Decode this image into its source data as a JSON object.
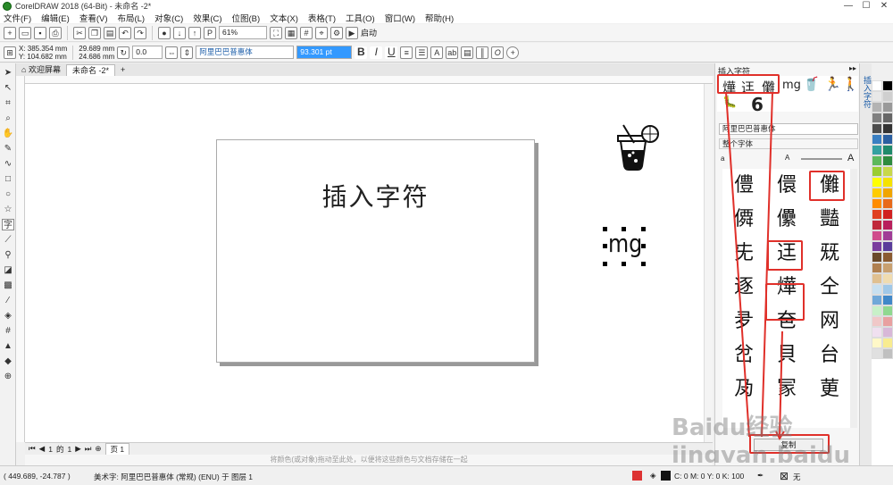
{
  "window": {
    "title": "CorelDRAW 2018 (64-Bit) - 未命名 -2*",
    "min": "—",
    "max": "☐",
    "close": "✕"
  },
  "menu": [
    "文件(F)",
    "编辑(E)",
    "查看(V)",
    "布局(L)",
    "对象(C)",
    "效果(C)",
    "位图(B)",
    "文本(X)",
    "表格(T)",
    "工具(O)",
    "窗口(W)",
    "帮助(H)"
  ],
  "toolbar1": {
    "zoom": "61%",
    "launch": "启动"
  },
  "toolbar2": {
    "x": "X: 385.354 mm",
    "y": "Y: 104.682 mm",
    "w": "29.689 mm",
    "h": "24.686 mm",
    "angle": "0.0",
    "font": "阿里巴巴普惠体",
    "size": "93.301 pt"
  },
  "tabs": [
    "欢迎屏幕",
    "未命名 -2*"
  ],
  "canvas": {
    "page_text": "插入字符",
    "selected_text": "mg"
  },
  "pagenav": {
    "pos": "1",
    "of": "的",
    "total": "1",
    "page_tab": "页 1"
  },
  "hint": "将颜色(或对象)拖动至此处，以便将这些颜色与文档存储在一起",
  "status": {
    "cursor": "( 449.689, -24.787 )",
    "object": "美术字: 阿里巴巴普惠体 (常规) (ENU) 于 图层 1",
    "fill": "C: 0 M: 0 Y: 0 K: 100",
    "outline": "无"
  },
  "docker": {
    "title": "插入字符",
    "recent": [
      "燁",
      "迋",
      "儺",
      "mg"
    ],
    "font": "阿里巴巴普惠体",
    "subset": "整个字体",
    "side_tab": "插入字符",
    "copy": "复制",
    "annotation": "6",
    "glyphs": [
      [
        "僼",
        "儇",
        "儺"
      ],
      [
        "僲",
        "儽",
        "豔"
      ],
      [
        "兂",
        "迋",
        "兓"
      ],
      [
        "逐",
        "燁",
        "仝"
      ],
      [
        "夛",
        "夿",
        "网"
      ],
      [
        "岔",
        "貝",
        "台"
      ],
      [
        "夃",
        "冡",
        "莄"
      ]
    ]
  },
  "watermark": "Baidu经验 jingyan.baidu.com",
  "colors": {
    "accent": "#e0302a",
    "selection": "#3399ff"
  }
}
